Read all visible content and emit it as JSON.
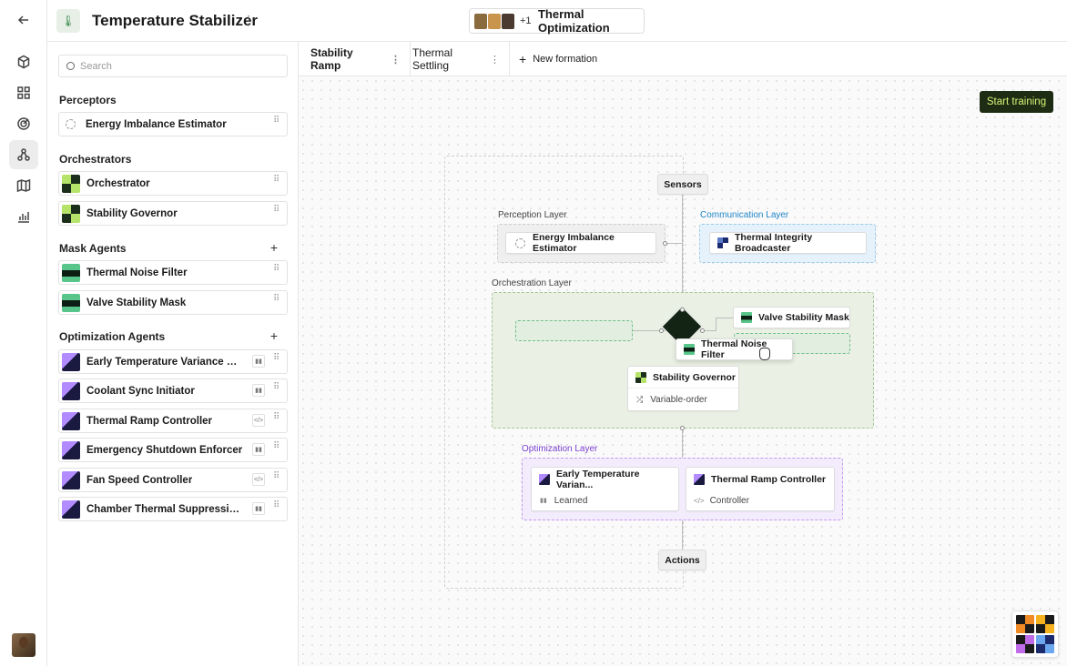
{
  "app": {
    "title": "Temperature Stabilizer",
    "more": "⋮"
  },
  "collab": {
    "extra": "+1",
    "title": "Thermal Optimization"
  },
  "sidebar": {
    "search_placeholder": "Search",
    "sections": [
      {
        "title": "Perceptors",
        "items": [
          {
            "label": "Energy Imbalance Estimator"
          }
        ]
      },
      {
        "title": "Orchestrators",
        "items": [
          {
            "label": "Orchestrator"
          },
          {
            "label": "Stability Governor"
          }
        ]
      },
      {
        "title": "Mask Agents",
        "add": "+",
        "items": [
          {
            "label": "Thermal Noise Filter"
          },
          {
            "label": "Valve Stability Mask"
          }
        ]
      },
      {
        "title": "Optimization Agents",
        "add": "+",
        "items": [
          {
            "label": "Early Temperature Variance Supp...",
            "tag": "learned"
          },
          {
            "label": "Coolant Sync Initiator",
            "tag": "learned"
          },
          {
            "label": "Thermal Ramp Controller",
            "tag": "code"
          },
          {
            "label": "Emergency Shutdown Enforcer",
            "tag": "learned"
          },
          {
            "label": "Fan Speed Controller",
            "tag": "code"
          },
          {
            "label": "Chamber Thermal Suppression A...",
            "tag": "learned"
          }
        ]
      }
    ]
  },
  "tabs": [
    {
      "label": "Stability Ramp",
      "active": true
    },
    {
      "label": "Thermal Settling"
    }
  ],
  "new_formation": "New formation",
  "start_training": "Start training",
  "graph": {
    "sensors": "Sensors",
    "actions": "Actions",
    "perception_layer": {
      "title": "Perception Layer",
      "node": "Energy Imbalance Estimator"
    },
    "communication_layer": {
      "title": "Communication Layer",
      "node": "Thermal Integrity Broadcaster"
    },
    "orchestration_layer": {
      "title": "Orchestration Layer",
      "valve": "Valve Stability Mask",
      "noise": "Thermal Noise Filter",
      "governor": "Stability Governor",
      "governor_sub": "Variable-order"
    },
    "optimization_layer": {
      "title": "Optimization Layer",
      "node1": "Early Temperature Varian...",
      "node1_sub": "Learned",
      "node2": "Thermal Ramp Controller",
      "node2_sub": "Controller"
    }
  },
  "colors": {
    "accent_green": "#1d2c12",
    "accent_lime": "#d8f57a",
    "communication_blue": "#1f86c9",
    "optimization_purple": "#7a3fcf"
  }
}
